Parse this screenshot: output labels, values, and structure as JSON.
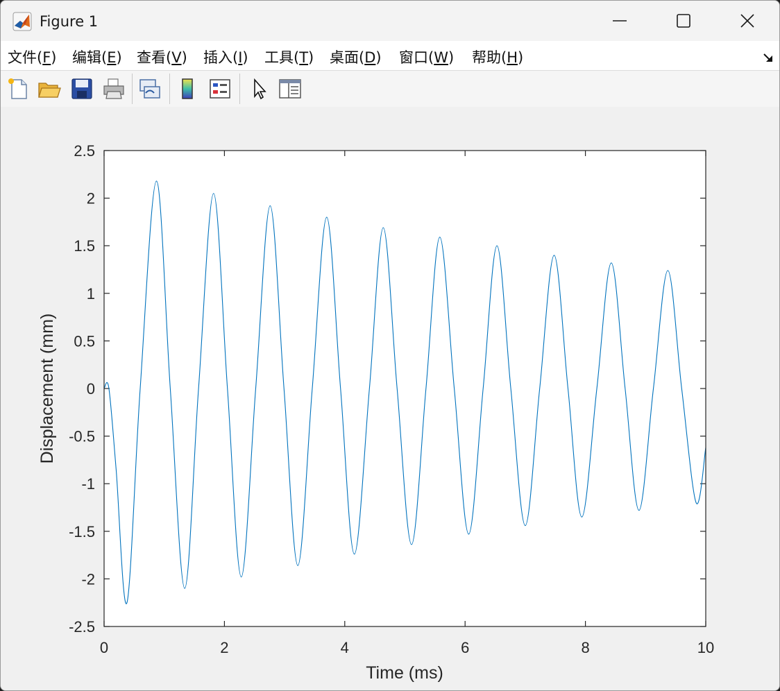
{
  "window": {
    "title": "Figure 1",
    "icon": "matlab-icon",
    "controls": [
      "minimize-icon",
      "maximize-icon",
      "close-icon"
    ]
  },
  "menu": {
    "items": [
      {
        "text": "文件(",
        "key": "F",
        "end": ")"
      },
      {
        "text": "编辑(",
        "key": "E",
        "end": ")"
      },
      {
        "text": "查看(",
        "key": "V",
        "end": ")"
      },
      {
        "text": "插入(",
        "key": "I",
        "end": ")"
      },
      {
        "text": "工具(",
        "key": "T",
        "end": ")"
      },
      {
        "text": "桌面(",
        "key": "D",
        "end": ")"
      },
      {
        "text": "窗口(",
        "key": "W",
        "end": ")"
      },
      {
        "text": "帮助(",
        "key": "H",
        "end": ")"
      }
    ],
    "dock_icon": "dock-arrow-icon"
  },
  "toolbar": {
    "buttons": [
      "new-figure-icon",
      "open-file-icon",
      "save-icon",
      "print-icon",
      "link-plot-icon",
      "insert-colorbar-icon",
      "insert-legend-icon",
      "edit-plot-icon",
      "property-inspector-icon"
    ]
  },
  "chart_data": {
    "type": "line",
    "title": "",
    "xlabel": "Time (ms)",
    "ylabel": "Displacement (mm)",
    "xlim": [
      0,
      10
    ],
    "ylim": [
      -2.5,
      2.5
    ],
    "xticks": [
      0,
      2,
      4,
      6,
      8,
      10
    ],
    "yticks": [
      2.5,
      2,
      1.5,
      1,
      0.5,
      0,
      -0.5,
      -1,
      -1.5,
      -2,
      -2.5
    ],
    "ytick_labels": [
      "2.5",
      "2",
      "1.5",
      "1",
      "0.5",
      "0",
      "-0.5",
      "-1",
      "-1.5",
      "-2",
      "-2.5"
    ],
    "xtick_labels": [
      "0",
      "2",
      "4",
      "6",
      "8",
      "10"
    ],
    "grid": false,
    "line_color": "#0072BD",
    "series": [
      {
        "name": "",
        "x": [
          0,
          0.08,
          0.2,
          0.38,
          0.6,
          0.87,
          1.1,
          1.34,
          1.57,
          1.82,
          2.05,
          2.28,
          2.52,
          2.76,
          2.99,
          3.22,
          3.46,
          3.7,
          3.93,
          4.16,
          4.41,
          4.64,
          4.87,
          5.11,
          5.35,
          5.58,
          5.82,
          6.06,
          6.3,
          6.53,
          6.76,
          7.0,
          7.24,
          7.48,
          7.71,
          7.94,
          8.19,
          8.43,
          8.66,
          8.89,
          9.13,
          9.37,
          9.6,
          9.84,
          10.0
        ],
        "y": [
          0,
          0,
          -0.85,
          -2.25,
          0,
          2.18,
          0,
          -2.1,
          0,
          2.05,
          0,
          -1.98,
          0,
          1.92,
          0,
          -1.86,
          0,
          1.8,
          0,
          -1.74,
          0,
          1.69,
          0,
          -1.64,
          0,
          1.59,
          0,
          -1.53,
          0,
          1.5,
          0,
          -1.44,
          0,
          1.4,
          0,
          -1.35,
          0,
          1.32,
          0,
          -1.28,
          0,
          1.24,
          0,
          -1.2,
          -0.62
        ]
      }
    ]
  }
}
